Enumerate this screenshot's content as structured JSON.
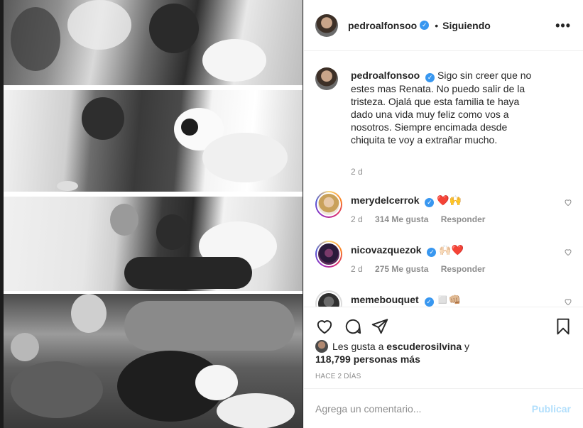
{
  "header": {
    "username": "pedroalfonsoo",
    "separator": "•",
    "following_label": "Siguiendo",
    "more_icon": "more-horizontal-icon"
  },
  "caption": {
    "username": "pedroalfonsoo",
    "text": "Sigo sin creer que no estes mas Renata. No puedo salir de la tristeza. Ojalá que esta familia te haya dado una vida muy feliz como vos a nosotros. Siempre encimada desde chiquita te voy a extrañar mucho.",
    "time": "2 d"
  },
  "comments": [
    {
      "username": "merydelcerrok",
      "text": "❤️🙌",
      "time": "2 d",
      "likes": "314 Me gusta",
      "reply": "Responder"
    },
    {
      "username": "nicovazquezok",
      "text": "🙌🏻❤️",
      "time": "2 d",
      "likes": "275 Me gusta",
      "reply": "Responder"
    },
    {
      "username": "memebouquet",
      "text": "◻️👊🏼",
      "time": "",
      "likes": "",
      "reply": ""
    }
  ],
  "actions": {
    "like_icon": "heart-icon",
    "comment_icon": "comment-icon",
    "share_icon": "send-icon",
    "save_icon": "bookmark-icon"
  },
  "likes": {
    "prefix": "Les gusta a",
    "user": "escuderosilvina",
    "conj": "y",
    "count": "118,799 personas más"
  },
  "time_ago": "HACE 2 DÍAS",
  "add_comment": {
    "placeholder": "Agrega un comentario...",
    "post_label": "Publicar"
  },
  "colors": {
    "verified": "#3897f0",
    "text": "#262626",
    "muted": "#8e8e8e",
    "post_disabled": "#b2dffc",
    "heart": "#ed4956"
  }
}
